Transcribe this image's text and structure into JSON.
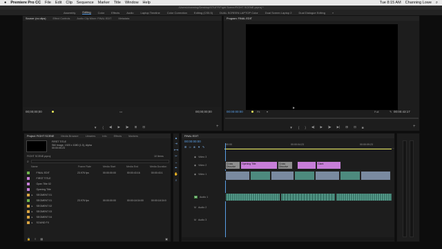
{
  "menubar": {
    "app": "Premiere Pro CC",
    "items": [
      "File",
      "Edit",
      "Clip",
      "Sequence",
      "Marker",
      "Title",
      "Window",
      "Help"
    ],
    "clock": "Tue 8:15 AM",
    "user": "Channing Lowe"
  },
  "titlebar": {
    "path": "/Users/channing/Desktop/STUFF/Fight Scene/FIGHT SCENE.prproj *"
  },
  "workspaces": [
    "Assembly",
    "Editing",
    "Color",
    "Effects",
    "Audio",
    "Laptop Timeline",
    "Color Correction",
    "Editing (CS5.5)",
    "DUAL SCREEN LAPTOP Color",
    "Dual Screen Laptop 2",
    "Dual Dialogue Editing"
  ],
  "active_workspace": "Editing",
  "source": {
    "tabs": [
      "Source: (no clips)",
      "Effect Controls",
      "Audio Clip Mixer: FINAL EDIT",
      "Metadata"
    ],
    "tc_left": "00;00;00;00",
    "tc_right": "00;00;00;00"
  },
  "program": {
    "tab": "Program: FINAL EDIT",
    "tc": "00:00:00:00",
    "fit": "Fit",
    "quality": "Full",
    "duration": "00:00:43:17"
  },
  "project": {
    "tabs": [
      "Project: FIGHT SCENE",
      "Media Browser",
      "Libraries",
      "Info",
      "Effects",
      "Markers"
    ],
    "preview": {
      "title": "FIRST TITLE",
      "line1": "Still Image, 1920 x 1080 (1.0), Alpha",
      "line2": "00:00:05:23"
    },
    "file": "FIGHT SCENE.prproj",
    "item_count": "10 Items",
    "columns": [
      "Name",
      "Frame Rate",
      "Media Start",
      "Media End",
      "Media Duration"
    ],
    "rows": [
      {
        "name": "FINAL EDIT",
        "rate": "23.976 fps",
        "start": "00:00:00:00",
        "end": "00:00:43:16",
        "dur": "00:00:43:1",
        "color": "#6fb44c",
        "folder": false
      },
      {
        "name": "FIRST TITLE",
        "rate": "",
        "start": "",
        "end": "",
        "dur": "",
        "color": "#c77ed8",
        "folder": false
      },
      {
        "name": "Open Title 02",
        "rate": "",
        "start": "",
        "end": "",
        "dur": "",
        "color": "#c77ed8",
        "folder": false
      },
      {
        "name": "Opening Title",
        "rate": "",
        "start": "",
        "end": "",
        "dur": "",
        "color": "#c77ed8",
        "folder": false
      },
      {
        "name": "SEGMENT 01",
        "rate": "",
        "start": "",
        "end": "",
        "dur": "",
        "color": "#d9a441",
        "folder": true
      },
      {
        "name": "SEGMENT 01",
        "rate": "23.976 fps",
        "start": "00:00:00:00",
        "end": "00:00:18:34:00",
        "dur": "00:00:18:34:0",
        "color": "#6fb44c",
        "folder": false
      },
      {
        "name": "SEGMENT 02",
        "rate": "",
        "start": "",
        "end": "",
        "dur": "",
        "color": "#d9a441",
        "folder": true
      },
      {
        "name": "SEGMENT 03",
        "rate": "",
        "start": "",
        "end": "",
        "dur": "",
        "color": "#d9a441",
        "folder": true
      },
      {
        "name": "SEGMENT 04",
        "rate": "",
        "start": "",
        "end": "",
        "dur": "",
        "color": "#d9a441",
        "folder": true
      },
      {
        "name": "SOUND FX",
        "rate": "",
        "start": "",
        "end": "",
        "dur": "",
        "color": "#d9a441",
        "folder": true
      }
    ]
  },
  "timeline": {
    "tab": "FINAL EDIT",
    "tc": "00:00:00:00",
    "ruler": [
      "00:00",
      "00:00:04:23",
      "00:00:09:23"
    ],
    "video_tracks": [
      "Video 3",
      "Video 2",
      "Video 1"
    ],
    "audio_tracks": [
      "Audio 1",
      "Audio 2",
      "Audio 3"
    ],
    "clips": {
      "opening_title": "Opening Title",
      "cross_dissolve": "Cross Dissolve",
      "giant": "Giant"
    }
  },
  "colors": {
    "accent": "#4a8fd8",
    "playhead": "#e8e85a"
  }
}
